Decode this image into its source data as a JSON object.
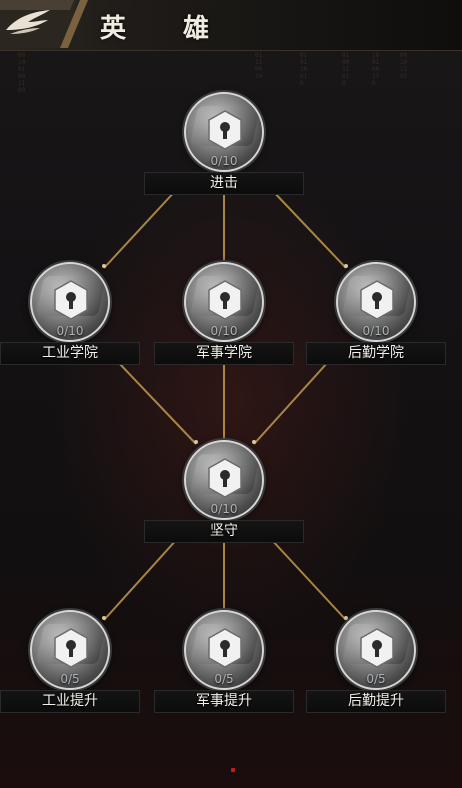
{
  "header": {
    "title": "英 雄"
  },
  "nodes": {
    "jinji": {
      "name": "进击",
      "progress": "0/10"
    },
    "gongye": {
      "name": "工业学院",
      "progress": "0/10"
    },
    "junshi": {
      "name": "军事学院",
      "progress": "0/10"
    },
    "houqin": {
      "name": "后勤学院",
      "progress": "0/10"
    },
    "jianshou": {
      "name": "坚守",
      "progress": "0/10"
    },
    "gongye_up": {
      "name": "工业提升",
      "progress": "0/5"
    },
    "junshi_up": {
      "name": "军事提升",
      "progress": "0/5"
    },
    "houqin_up": {
      "name": "后勤提升",
      "progress": "0/5"
    }
  },
  "colors": {
    "link": "#b8924a",
    "accent": "#c81c1c"
  },
  "icons": {
    "back": "wing-emblem-icon",
    "node": "keyhole-lock-icon"
  }
}
